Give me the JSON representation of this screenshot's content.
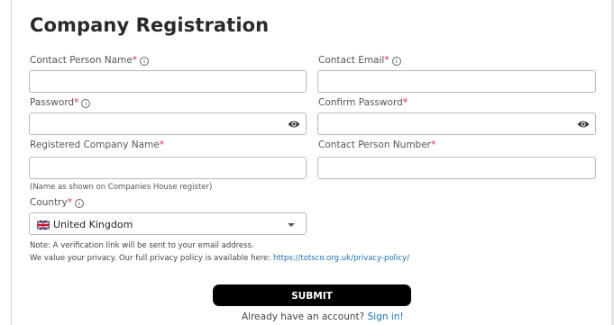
{
  "form": {
    "title": "Company Registration",
    "required_mark": "*",
    "fields": {
      "contact_name": {
        "label": "Contact Person Name",
        "value": ""
      },
      "contact_email": {
        "label": "Contact Email",
        "value": ""
      },
      "password": {
        "label": "Password",
        "value": ""
      },
      "confirm_password": {
        "label": "Confirm Password",
        "value": ""
      },
      "company_name": {
        "label": "Registered Company Name",
        "value": "",
        "hint": "(Name as shown on Companies House register)"
      },
      "contact_number": {
        "label": "Contact Person Number",
        "value": ""
      },
      "country": {
        "label": "Country",
        "value": "United Kingdom"
      }
    },
    "info_icon": "i",
    "note_line1": "Note: A verification link will be sent to your email address.",
    "note_line2": "We value your privacy. Our full privacy policy is available here: ",
    "privacy_link": "https://totsco.org.uk/privacy-policy/",
    "submit_label": "SUBMIT",
    "account_text": "Already have an account? ",
    "signin_link": "Sign in!"
  },
  "colors": {
    "required": "#e0284a",
    "link": "#1a6fb5",
    "button": "#000000"
  },
  "icons": {
    "password_toggle": "eye-icon",
    "confirm_toggle": "eye-icon",
    "country_flag": "uk-flag-icon",
    "dropdown": "chevron-down-icon"
  }
}
